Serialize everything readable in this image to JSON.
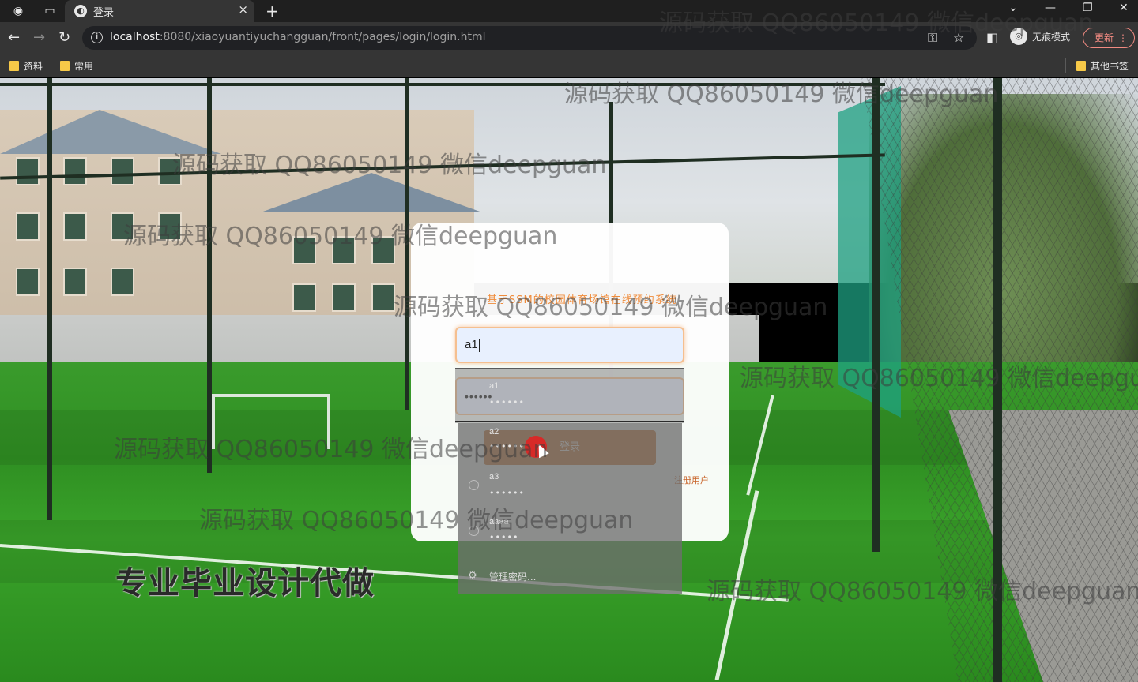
{
  "browser": {
    "tab_title": "登录",
    "url_host": "localhost",
    "url_rest": ":8080/xiaoyuantiyuchangguan/front/pages/login/login.html",
    "incognito_label": "无痕模式",
    "update_label": "更新",
    "bookmarks": [
      "资料",
      "常用"
    ],
    "other_bookmarks": "其他书签"
  },
  "login": {
    "title": "基于SSM的校园体育场馆在线预约系统",
    "username_value": "a1",
    "password_value": "••••••",
    "login_button": "登录",
    "register_link": "注册用户"
  },
  "autofill": {
    "items": [
      {
        "user": "a1",
        "pass": "••••••"
      },
      {
        "user": "a2",
        "pass": "••••••"
      },
      {
        "user": "a3",
        "pass": "••••••"
      },
      {
        "user": "aaaa",
        "pass": "•••••"
      }
    ],
    "manage_label": "管理密码..."
  },
  "watermark": "源码获取 QQ86050149 微信deepguan",
  "promo": "专业毕业设计代做"
}
